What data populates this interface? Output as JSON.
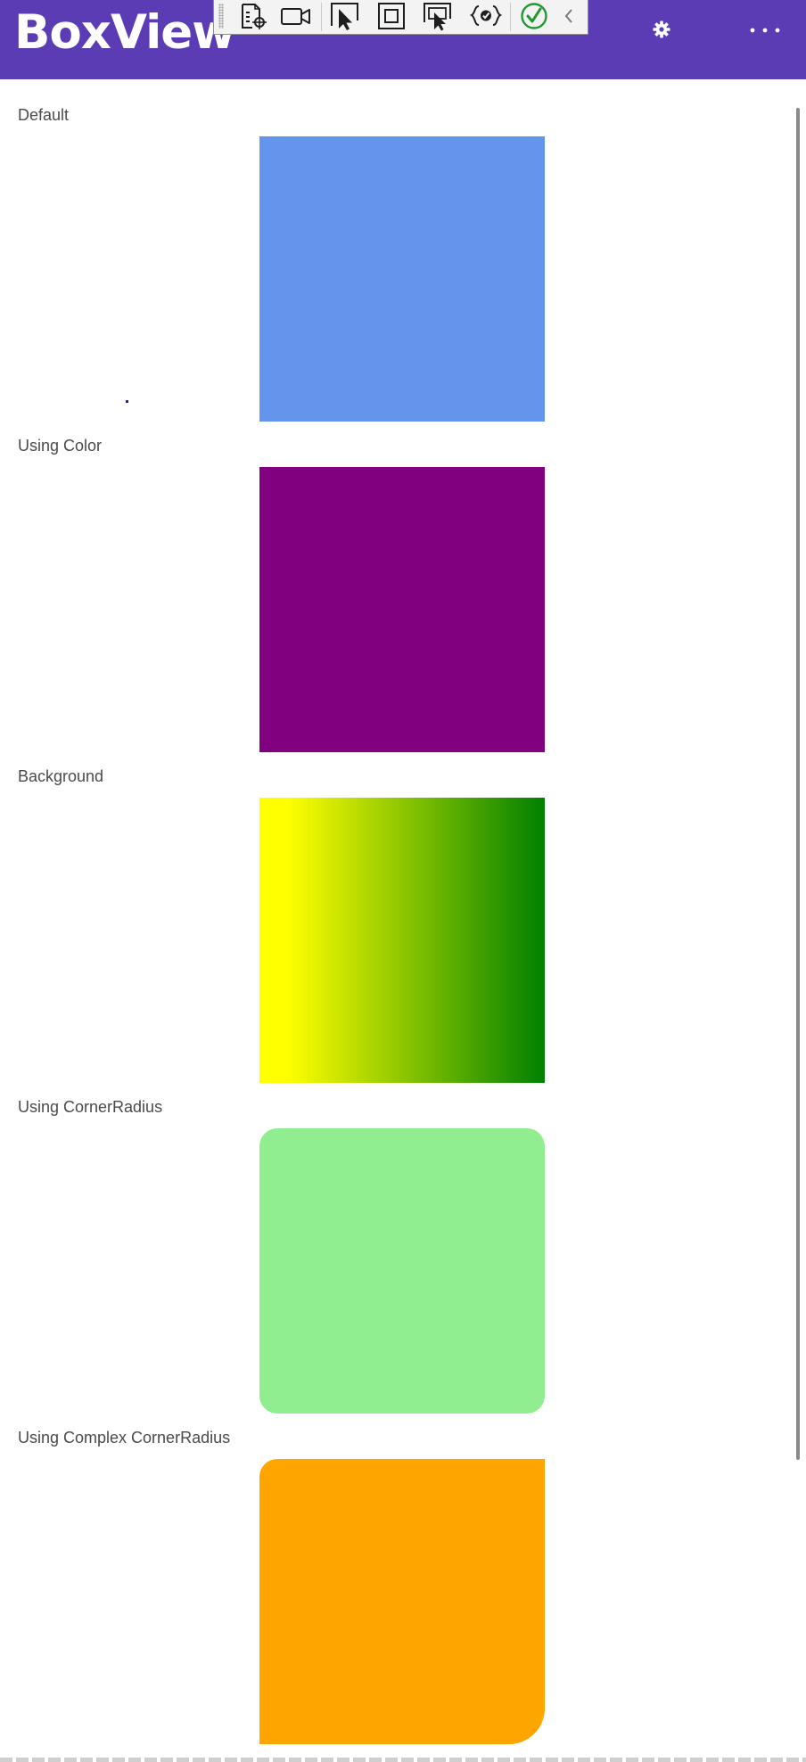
{
  "header": {
    "title": "BoxView",
    "background": "#5b3cb4",
    "gear_icon": "gear-icon",
    "more_icon": "more-horizontal-icon"
  },
  "dev_toolbar": {
    "buttons": [
      "live-visual-tree-icon",
      "record-video-icon",
      "select-element-icon",
      "display-layout-adorners-icon",
      "track-focused-element-icon",
      "binding-failures-icon",
      "hot-reload-status-icon",
      "collapse-toolbar-icon"
    ]
  },
  "sections": [
    {
      "label": "Default",
      "color": "#6495ed",
      "style": "solid"
    },
    {
      "label": "Using Color",
      "color": "#800080",
      "style": "solid"
    },
    {
      "label": "Background",
      "color_start": "#ffff00",
      "color_end": "#008000",
      "style": "gradient"
    },
    {
      "label": "Using CornerRadius",
      "color": "#90ee90",
      "style": "rounded"
    },
    {
      "label": "Using Complex CornerRadius",
      "color": "#ffa500",
      "style": "complex-rounded"
    }
  ]
}
